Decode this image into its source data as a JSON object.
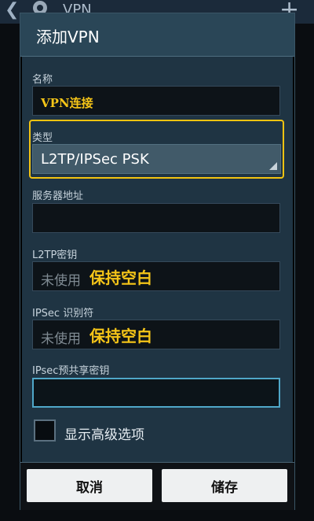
{
  "background": {
    "app_title": "VPN",
    "back_icon": "chevron-left-icon",
    "settings_icon": "gear-icon",
    "add_icon": "plus-icon"
  },
  "dialog": {
    "title": "添加VPN",
    "fields": {
      "name": {
        "label": "名称",
        "value": "VPN连接"
      },
      "type": {
        "label": "类型",
        "selected": "L2TP/IPSec PSK"
      },
      "server": {
        "label": "服务器地址",
        "value": ""
      },
      "l2tp_secret": {
        "label": "L2TP密钥",
        "placeholder": "未使用",
        "annotation": "保持空白"
      },
      "ipsec_id": {
        "label": "IPSec 识别符",
        "placeholder": "未使用",
        "annotation": "保持空白"
      },
      "ipsec_psk": {
        "label": "IPsec预共享密钥",
        "value": ""
      }
    },
    "advanced": {
      "label": "显示高级选项",
      "checked": false
    },
    "buttons": {
      "cancel": "取消",
      "save": "储存"
    }
  },
  "colors": {
    "highlight": "#f2c311",
    "annotation": "#f5c518",
    "focus": "#4fa7c8",
    "dialog_bg": "#1f3443"
  }
}
